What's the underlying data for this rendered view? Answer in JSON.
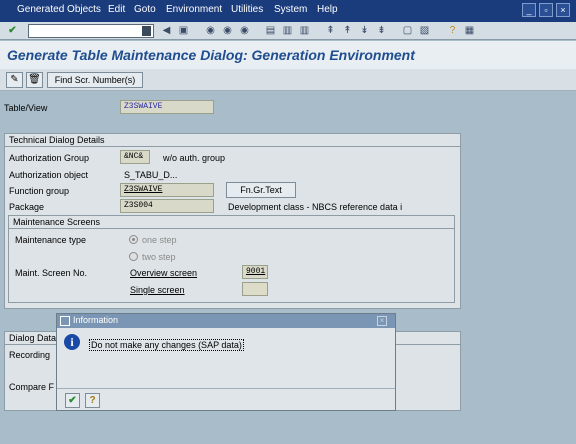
{
  "menu": [
    "Generated Objects",
    "Edit",
    "Goto",
    "Environment",
    "Utilities",
    "System",
    "Help"
  ],
  "title": "Generate Table Maintenance Dialog: Generation Environment",
  "app_toolbar": {
    "find_label": "Find Scr. Number(s)"
  },
  "table_view": {
    "label": "Table/View",
    "value": "Z3SWAIVE"
  },
  "technical": {
    "group_title": "Technical Dialog Details",
    "auth_group_label": "Authorization Group",
    "auth_group_value": "&NC&",
    "auth_group_text": "w/o auth. group",
    "auth_object_label": "Authorization object",
    "auth_object_value": "S_TABU_D...",
    "function_group_label": "Function group",
    "function_group_value": "Z3SWAIVE",
    "fn_gr_text_button": "Fn.Gr.Text",
    "package_label": "Package",
    "package_value": "Z3S004",
    "package_text": "Development class - NBCS reference data i"
  },
  "maintenance": {
    "group_title": "Maintenance Screens",
    "type_label": "Maintenance type",
    "one_step": "one step",
    "two_step": "two step",
    "screen_no_label": "Maint. Screen No.",
    "overview_label": "Overview screen",
    "overview_value": "9001",
    "single_label": "Single screen",
    "single_value": ""
  },
  "dialog_data": {
    "group_title": "Dialog Data",
    "recording_label": "Recording",
    "compare_label": "Compare F"
  },
  "popup": {
    "title": "Information",
    "message": "Do not make any changes (SAP data)"
  },
  "colors": {
    "menubar": "#1a3b7c",
    "title": "#1f4d8f",
    "background": "#a8bdc9",
    "popup_header": "#7b96b4"
  }
}
